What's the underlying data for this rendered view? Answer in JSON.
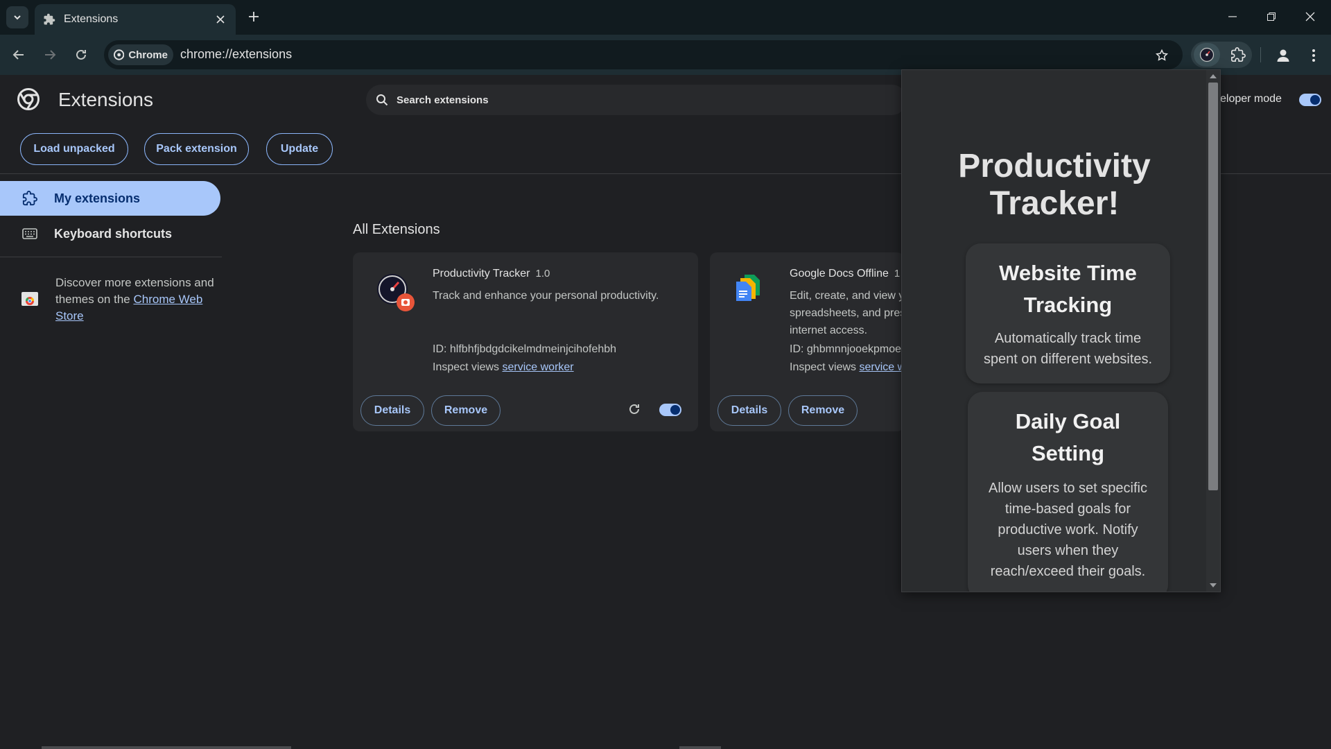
{
  "browser": {
    "tab_title": "Extensions",
    "chip_label": "Chrome",
    "url": "chrome://extensions"
  },
  "page": {
    "title": "Extensions",
    "search_placeholder": "Search extensions",
    "dev_mode_label": "eloper mode",
    "dev_mode_on": true,
    "actions": {
      "load_unpacked": "Load unpacked",
      "pack_extension": "Pack extension",
      "update": "Update"
    }
  },
  "sidebar": {
    "items": [
      {
        "label": "My extensions",
        "icon": "extensions-icon",
        "active": true
      },
      {
        "label": "Keyboard shortcuts",
        "icon": "keyboard-icon",
        "active": false
      }
    ],
    "discover_text_1": "Discover more extensions and themes on the ",
    "discover_link": "Chrome Web Store"
  },
  "content": {
    "section_title": "All Extensions",
    "cards": [
      {
        "name": "Productivity Tracker",
        "version": "1.0",
        "description": "Track and enhance your personal productivity.",
        "id": "ID: hlfbhfjbdgdcikelmdmeinjcihofehbh",
        "inspect_label": "Inspect views ",
        "inspect_link": "service worker",
        "details": "Details",
        "remove": "Remove",
        "enabled": true
      },
      {
        "name": "Google Docs Offline",
        "version": "1",
        "description_lines": [
          "Edit, create, and view y",
          "spreadsheets, and pres",
          "internet access."
        ],
        "id": "ID: ghbmnnjooekpmoe",
        "inspect_label": "Inspect views ",
        "inspect_link": "service w",
        "details": "Details",
        "remove": "Remove"
      }
    ]
  },
  "popup": {
    "title_line1": "Productivity",
    "title_line2": "Tracker!",
    "features": [
      {
        "title_lines": [
          "Website Time",
          "Tracking"
        ],
        "desc_lines": [
          "Automatically track time",
          "spent on different websites."
        ]
      },
      {
        "title_lines": [
          "Daily Goal",
          "Setting"
        ],
        "desc_lines": [
          "Allow users to set specific",
          "time-based goals for",
          "productive work. Notify",
          "users when they",
          "reach/exceed their goals."
        ]
      }
    ]
  },
  "colors": {
    "accent": "#a8c7fa",
    "background": "#1f2023",
    "card": "#292a2d",
    "chrome_frame": "#111b1f"
  }
}
